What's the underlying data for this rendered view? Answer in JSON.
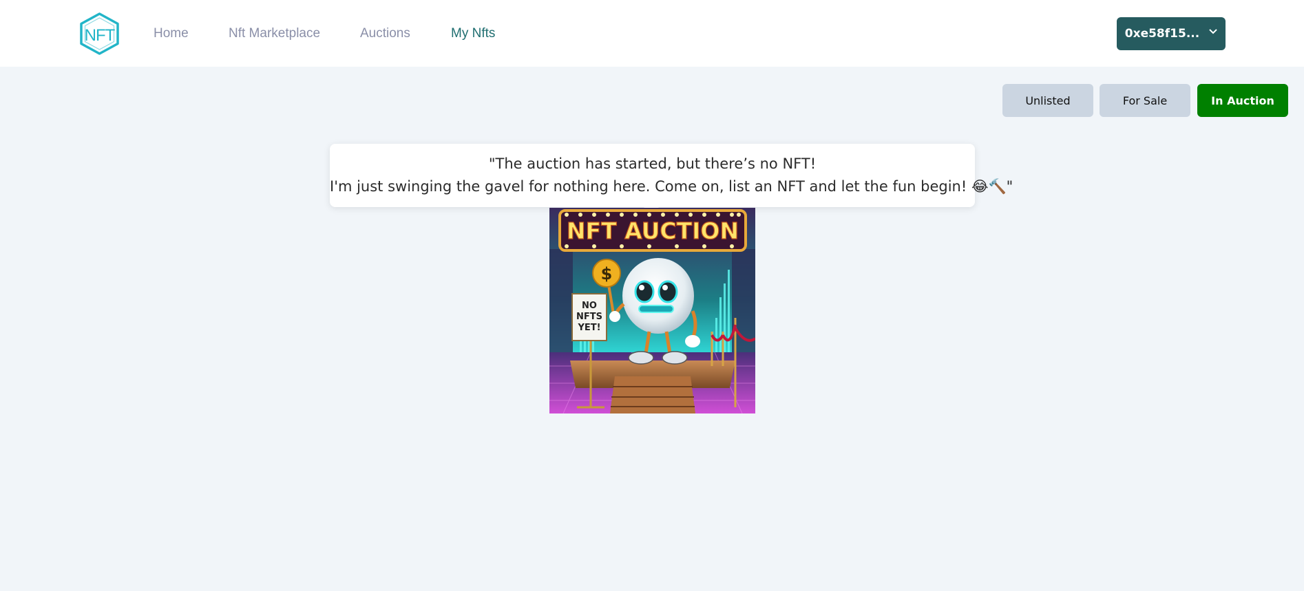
{
  "header": {
    "logo_text": "NFT",
    "nav": [
      {
        "label": "Home"
      },
      {
        "label": "Nft Marketplace"
      },
      {
        "label": "Auctions"
      },
      {
        "label": "My Nfts",
        "active": true
      }
    ],
    "wallet": {
      "label": "0xe58f15...",
      "icon": "chevron-down-icon"
    }
  },
  "filters": [
    {
      "label": "Unlisted"
    },
    {
      "label": "For Sale"
    },
    {
      "label": "In Auction",
      "active": true
    }
  ],
  "empty_state": {
    "line1": "\"The auction has started, but there’s no NFT!",
    "line2": "I'm just swinging the gavel for nothing here. Come on, list an NFT and let the fun begin! 😂🔨\"",
    "image": {
      "banner": "NFT AUCTION",
      "sign": [
        "NO",
        "NFTS",
        "YET!"
      ],
      "coin_symbol": "$"
    }
  },
  "colors": {
    "accent": "#265b5f",
    "active_nav": "#1f6e70",
    "in_auction": "#008000",
    "filter_inactive": "#cbd5e1",
    "background": "#f1f5f9"
  }
}
